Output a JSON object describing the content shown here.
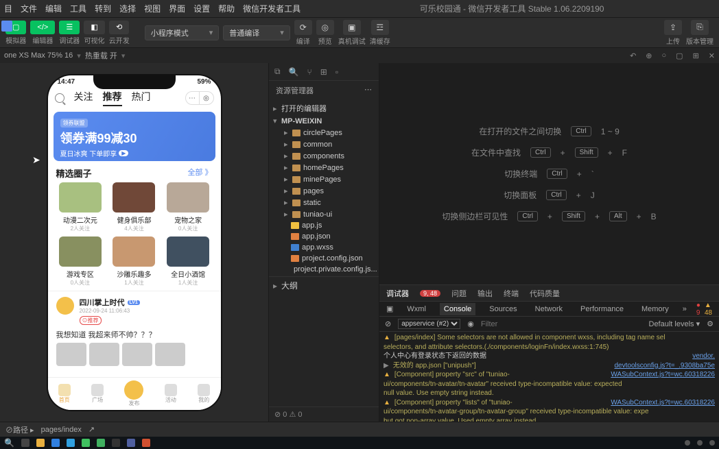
{
  "menu": [
    "目",
    "文件",
    "编辑",
    "工具",
    "转到",
    "选择",
    "视图",
    "界面",
    "设置",
    "帮助",
    "微信开发者工具"
  ],
  "title_center": "可乐校园通 - 微信开发者工具 Stable 1.06.2209190",
  "toolbar": {
    "items": [
      {
        "label": "模拟器",
        "cls": "green",
        "icon": "▢"
      },
      {
        "label": "编辑器",
        "cls": "green",
        "icon": "</>"
      },
      {
        "label": "调试器",
        "cls": "green",
        "icon": "☰"
      },
      {
        "label": "可视化",
        "cls": "gray",
        "icon": "◧"
      },
      {
        "label": "云开发",
        "cls": "gray",
        "icon": "⟲"
      }
    ],
    "mode_select": "小程序模式",
    "compile_select": "普通编译",
    "actions": [
      {
        "label": "编译",
        "icon": "⟳"
      },
      {
        "label": "预览",
        "icon": "◎"
      },
      {
        "label": "真机调试",
        "icon": "▣"
      },
      {
        "label": "清缓存",
        "icon": "☲"
      }
    ],
    "right": [
      {
        "label": "上传",
        "icon": "⇪"
      },
      {
        "label": "版本管理",
        "icon": "⎘"
      }
    ]
  },
  "status": {
    "device": "one XS Max 75% 16",
    "hot": "热重载 开",
    "icons": [
      "↶",
      "⊕",
      "○",
      "▢",
      "⊞",
      "✕"
    ]
  },
  "phone": {
    "time": "14:47",
    "battery": "59%",
    "tabs": [
      "关注",
      "推荐",
      "热门"
    ],
    "banner_tag": "领券联盟",
    "banner_title": "领券满99减30",
    "banner_sub": "夏日冰爽 下单即享",
    "banner_btn": "▶",
    "section": "精选圈子",
    "more": "全部 》",
    "cards": [
      {
        "t1": "动漫二次元",
        "t2": "2人关注",
        "bg": "#a8c080"
      },
      {
        "t1": "健身俱乐部",
        "t2": "4人关注",
        "bg": "#704838"
      },
      {
        "t1": "宠物之家",
        "t2": "0人关注",
        "bg": "#b8a898"
      },
      {
        "t1": "游戏专区",
        "t2": "0人关注",
        "bg": "#889060"
      },
      {
        "t1": "沙雕乐趣多",
        "t2": "1人关注",
        "bg": "#c89870"
      },
      {
        "t1": "全日小酒馆",
        "t2": "1人关注",
        "bg": "#405060"
      }
    ],
    "post": {
      "name": "四川掌上时代",
      "lv": "LV1",
      "time": "2022-09-24 11:06:43",
      "tag": "⊙推荐",
      "body": "我想知道 我超来师不帅？？？"
    },
    "tabbar": [
      "首页",
      "广场",
      "发布",
      "活动",
      "我的"
    ]
  },
  "explorer": {
    "title": "资源管理器",
    "open_editors": "打开的编辑器",
    "root": "MP-WEIXIN",
    "folders": [
      "circlePages",
      "common",
      "components",
      "homePages",
      "minePages",
      "pages",
      "static",
      "tuniao-ui"
    ],
    "files": [
      {
        "name": "app.js",
        "cls": "js"
      },
      {
        "name": "app.json",
        "cls": "json"
      },
      {
        "name": "app.wxss",
        "cls": "wxss"
      },
      {
        "name": "project.config.json",
        "cls": "json"
      },
      {
        "name": "project.private.config.js...",
        "cls": "json"
      }
    ],
    "outline": "大纲",
    "stats": "⊘ 0 ⚠ 0"
  },
  "shortcuts": [
    {
      "label": "在打开的文件之间切换",
      "keys": [
        "Ctrl",
        "1 ~ 9"
      ]
    },
    {
      "label": "在文件中查找",
      "keys": [
        "Ctrl",
        "+",
        "Shift",
        "+",
        "F"
      ]
    },
    {
      "label": "切换终端",
      "keys": [
        "Ctrl",
        "+",
        "`"
      ]
    },
    {
      "label": "切换面板",
      "keys": [
        "Ctrl",
        "+",
        "J"
      ]
    },
    {
      "label": "切换侧边栏可见性",
      "keys": [
        "Ctrl",
        "+",
        "Shift",
        "+",
        "Alt",
        "+",
        "B"
      ]
    }
  ],
  "debugger": {
    "top_tabs": [
      "调试器",
      "问题",
      "输出",
      "终端",
      "代码质量"
    ],
    "bubble": "9, 48",
    "dev_tabs": [
      "Wxml",
      "Console",
      "Sources",
      "Network",
      "Performance",
      "Memory"
    ],
    "err_count": "9",
    "warn_count": "48",
    "scope": "appservice (#2)",
    "filter_ph": "Filter",
    "levels": "Default levels ▾",
    "lines": [
      {
        "type": "warn",
        "text": "[pages/index] Some selectors are not allowed in component wxss, including tag name sel",
        "link": ""
      },
      {
        "type": "plain",
        "text": "selectors, and attribute selectors.(./components/loginFn/index.wxss:1:745)",
        "link": ""
      },
      {
        "type": "gray",
        "text": "个人中心有登录状态下返回的数据",
        "link": "vendor."
      },
      {
        "type": "info",
        "text": "无效的 app.json [\"unipush\"]",
        "link": "devtoolsconfig.js?t=_.9308ba75e"
      },
      {
        "type": "warn",
        "text": "[Component] property \"src\" of \"tuniao-",
        "link": "WASubContext.js?t=wc.60318226"
      },
      {
        "type": "plain",
        "text": "ui/components/tn-avatar/tn-avatar\" received type-incompatible value: expected <String>",
        "link": ""
      },
      {
        "type": "plain",
        "text": "null value. Use empty string instead.",
        "link": ""
      },
      {
        "type": "warn",
        "text": "[Component] property \"lists\" of \"tuniao-",
        "link": "WASubContext.js?t=wc.60318226"
      },
      {
        "type": "plain",
        "text": "ui/components/tn-avatar-group/tn-avatar-group\" received type-incompatible value: expe",
        "link": ""
      },
      {
        "type": "plain",
        "text": "but got non-array value. Used empty array instead.",
        "link": ""
      }
    ]
  },
  "footer": {
    "left": "⊘路径 ▸",
    "path": "pages/index",
    "icon": "↗"
  }
}
